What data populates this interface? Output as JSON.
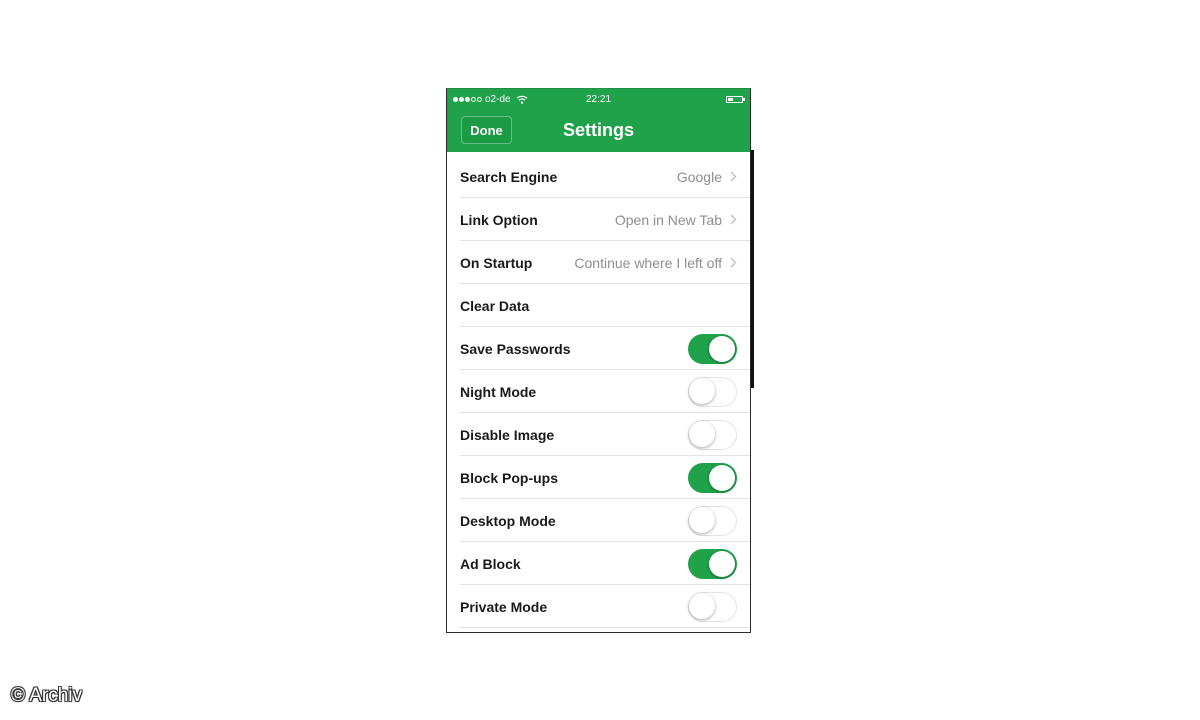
{
  "status_bar": {
    "carrier": "o2-de",
    "time": "22:21"
  },
  "nav": {
    "done_label": "Done",
    "title": "Settings"
  },
  "settings": {
    "items": [
      {
        "label": "Search Engine",
        "value": "Google",
        "type": "disclosure"
      },
      {
        "label": "Link Option",
        "value": "Open in New Tab",
        "type": "disclosure"
      },
      {
        "label": "On Startup",
        "value": "Continue where I left off",
        "type": "disclosure"
      },
      {
        "label": "Clear Data",
        "type": "action"
      },
      {
        "label": "Save Passwords",
        "type": "toggle",
        "on": true
      },
      {
        "label": "Night Mode",
        "type": "toggle",
        "on": false
      },
      {
        "label": "Disable Image",
        "type": "toggle",
        "on": false
      },
      {
        "label": "Block Pop-ups",
        "type": "toggle",
        "on": true
      },
      {
        "label": "Desktop Mode",
        "type": "toggle",
        "on": false
      },
      {
        "label": "Ad Block",
        "type": "toggle",
        "on": true
      },
      {
        "label": "Private Mode",
        "type": "toggle",
        "on": false
      }
    ]
  },
  "watermark": "© Archiv",
  "colors": {
    "accent": "#1fa24a",
    "value_text": "#8e8e93"
  },
  "icons": [
    "signal-dots-icon",
    "wifi-icon",
    "battery-icon",
    "chevron-right-icon"
  ]
}
